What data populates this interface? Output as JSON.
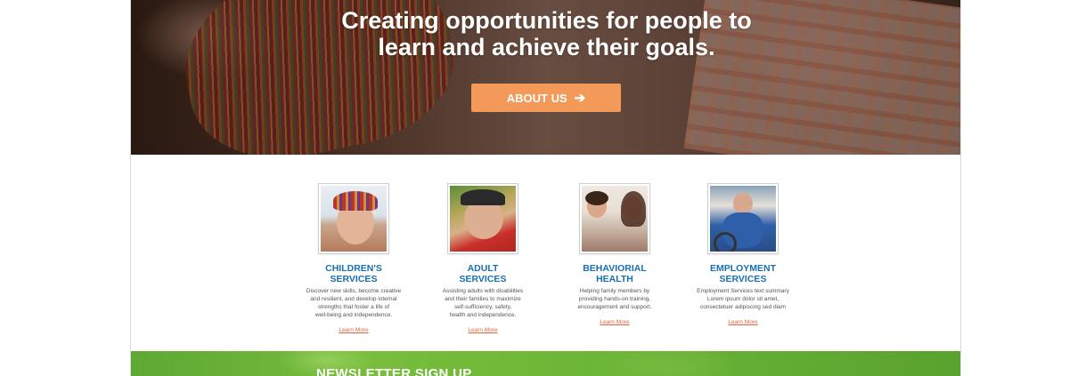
{
  "hero": {
    "headline_line1": "Creating opportunities for people to",
    "headline_line2": "learn and achieve their goals.",
    "button_label": "ABOUT US",
    "button_icon": "arrow-right-icon",
    "button_color": "#f39a5a"
  },
  "services": [
    {
      "title_line1": "CHILDREN'S",
      "title_line2": "SERVICES",
      "desc": [
        "Discover new skills, become creative",
        "and resilient, and develop internal",
        "strengths that foster a life of",
        "well-being and independence."
      ],
      "link": "Learn More"
    },
    {
      "title_line1": "ADULT",
      "title_line2": "SERVICES",
      "desc": [
        "Assisting adults with disabilities",
        "and their families to maximize",
        "self-sufficiency, safety,",
        "health and independence."
      ],
      "link": "Learn More"
    },
    {
      "title_line1": "BEHAVIORIAL",
      "title_line2": "HEALTH",
      "desc": [
        "Helping family members by",
        "providing hands-on training,",
        "encouragement and support."
      ],
      "link": "Learn More"
    },
    {
      "title_line1": "EMPLOYMENT",
      "title_line2": "SERVICES",
      "desc": [
        "Employment Services text summary",
        "Lorem ipsum dolor sit amet,",
        "consectetuer adipiscing sed diam"
      ],
      "link": "Learn More"
    }
  ],
  "newsletter": {
    "title": "NEWSLETTER SIGN UP"
  },
  "colors": {
    "service_title": "#1a6fb3",
    "link": "#e0663a",
    "newsletter_bg": "#6ab436"
  }
}
